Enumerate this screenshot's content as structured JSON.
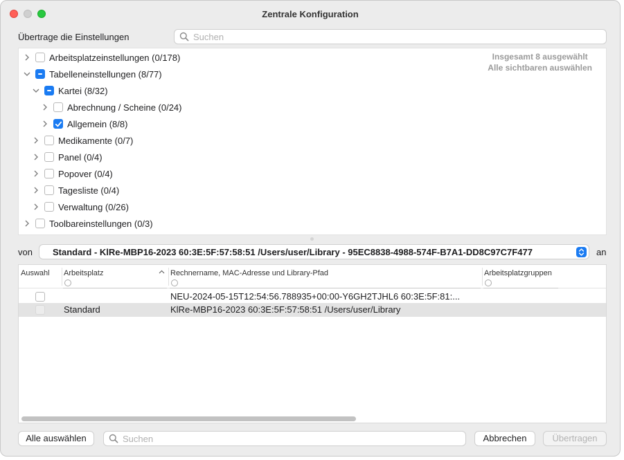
{
  "window": {
    "title": "Zentrale Konfiguration"
  },
  "top": {
    "label": "Übertrage die Einstellungen",
    "search_placeholder": "Suchen"
  },
  "summary": {
    "selected_total": "Insgesamt 8 ausgewählt",
    "select_all_visible": "Alle sichtbaren auswählen"
  },
  "tree": {
    "items": [
      {
        "label": "Arbeitsplatzeinstellungen (0/178)",
        "state": "unchecked",
        "expanded": false
      },
      {
        "label": "Tabelleneinstellungen (8/77)",
        "state": "mixed",
        "expanded": true
      },
      {
        "label": "Kartei (8/32)",
        "state": "mixed",
        "expanded": true
      },
      {
        "label": "Abrechnung / Scheine (0/24)",
        "state": "unchecked",
        "expanded": false
      },
      {
        "label": "Allgemein (8/8)",
        "state": "checked",
        "expanded": false
      },
      {
        "label": "Medikamente (0/7)",
        "state": "unchecked",
        "expanded": false
      },
      {
        "label": "Panel (0/4)",
        "state": "unchecked",
        "expanded": false
      },
      {
        "label": "Popover (0/4)",
        "state": "unchecked",
        "expanded": false
      },
      {
        "label": "Tagesliste (0/4)",
        "state": "unchecked",
        "expanded": false
      },
      {
        "label": "Verwaltung (0/26)",
        "state": "unchecked",
        "expanded": false
      },
      {
        "label": "Toolbareinstellungen (0/3)",
        "state": "unchecked",
        "expanded": false
      }
    ]
  },
  "source": {
    "von_label": "von",
    "an_label": "an",
    "selected": "Standard - KlRe-MBP16-2023 60:3E:5F:57:58:51 /Users/user/Library - 95EC8838-4988-574F-B7A1-DD8C97C7F477"
  },
  "table": {
    "columns": [
      "Auswahl",
      "Arbeitsplatz",
      "Rechnername, MAC-Adresse und Library-Pfad",
      "Arbeitsplatzgruppen"
    ],
    "rows": [
      {
        "arbeitsplatz": "",
        "rechner": "NEU-2024-05-15T12:54:56.788935+00:00-Y6GH2TJHL6 60:3E:5F:81:...",
        "gruppen": ""
      },
      {
        "arbeitsplatz": "Standard",
        "rechner": "KlRe-MBP16-2023 60:3E:5F:57:58:51 /Users/user/Library",
        "gruppen": ""
      }
    ]
  },
  "bottom": {
    "select_all_label": "Alle auswählen",
    "search_placeholder": "Suchen",
    "cancel_label": "Abbrechen",
    "apply_label": "Übertragen"
  }
}
